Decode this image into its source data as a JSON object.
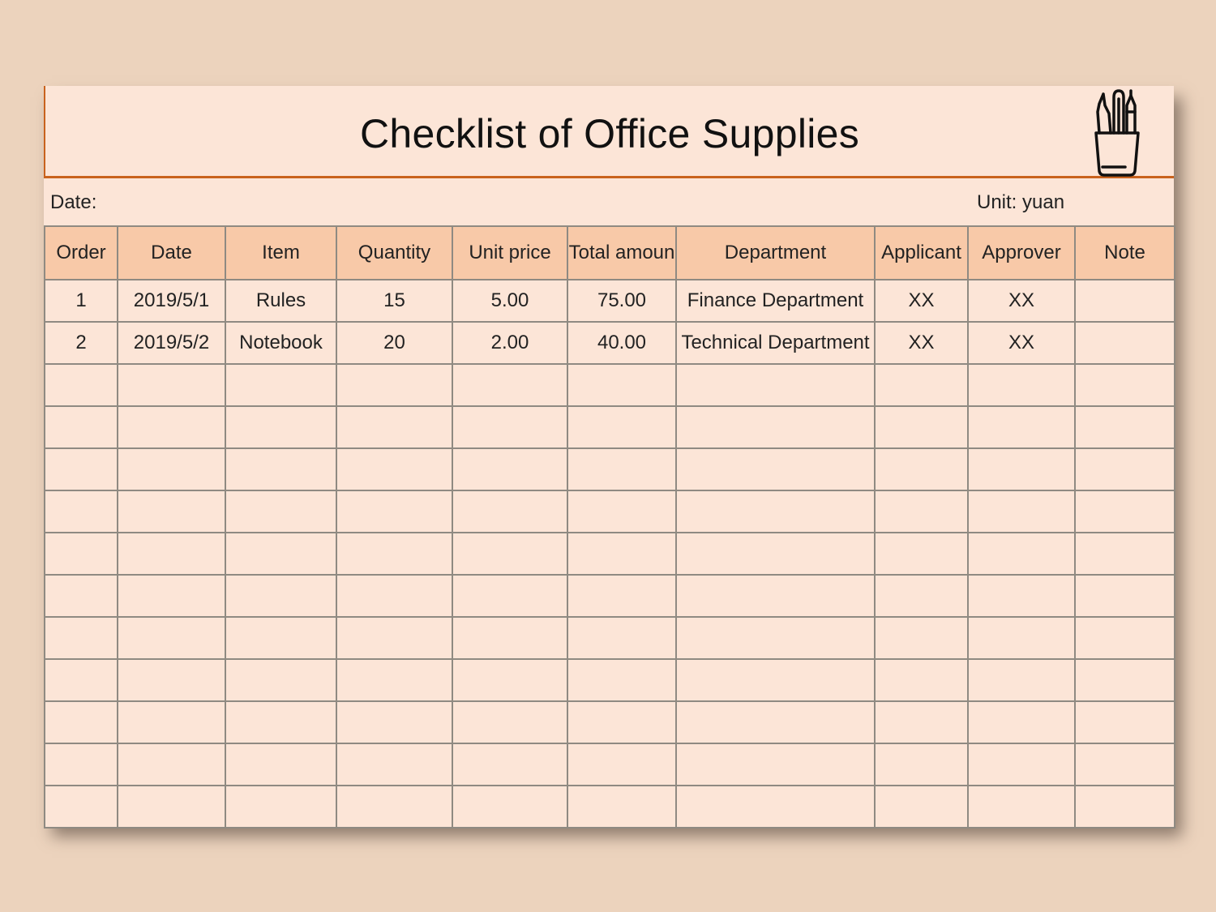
{
  "document": {
    "title": "Checklist of Office Supplies",
    "icon": "pencil-cup-icon",
    "date_label": "Date:",
    "unit_label": "Unit: yuan"
  },
  "colors": {
    "background": "#ecd3bd",
    "sheet": "#fce5d7",
    "header_fill": "#f8c9a8",
    "accent_line": "#c9621d",
    "grid_line": "#8f8a82"
  },
  "table": {
    "columns": [
      "Order",
      "Date",
      "Item",
      "Quantity",
      "Unit price",
      "Total amoun",
      "Department",
      "Applicant",
      "Approver",
      "Note"
    ],
    "rows": [
      [
        "1",
        "2019/5/1",
        "Rules",
        "15",
        "5.00",
        "75.00",
        "Finance Department",
        "XX",
        "XX",
        ""
      ],
      [
        "2",
        "2019/5/2",
        "Notebook",
        "20",
        "2.00",
        "40.00",
        "Technical Department",
        "XX",
        "XX",
        ""
      ],
      [
        "",
        "",
        "",
        "",
        "",
        "",
        "",
        "",
        "",
        ""
      ],
      [
        "",
        "",
        "",
        "",
        "",
        "",
        "",
        "",
        "",
        ""
      ],
      [
        "",
        "",
        "",
        "",
        "",
        "",
        "",
        "",
        "",
        ""
      ],
      [
        "",
        "",
        "",
        "",
        "",
        "",
        "",
        "",
        "",
        ""
      ],
      [
        "",
        "",
        "",
        "",
        "",
        "",
        "",
        "",
        "",
        ""
      ],
      [
        "",
        "",
        "",
        "",
        "",
        "",
        "",
        "",
        "",
        ""
      ],
      [
        "",
        "",
        "",
        "",
        "",
        "",
        "",
        "",
        "",
        ""
      ],
      [
        "",
        "",
        "",
        "",
        "",
        "",
        "",
        "",
        "",
        ""
      ],
      [
        "",
        "",
        "",
        "",
        "",
        "",
        "",
        "",
        "",
        ""
      ],
      [
        "",
        "",
        "",
        "",
        "",
        "",
        "",
        "",
        "",
        ""
      ],
      [
        "",
        "",
        "",
        "",
        "",
        "",
        "",
        "",
        "",
        ""
      ]
    ]
  }
}
